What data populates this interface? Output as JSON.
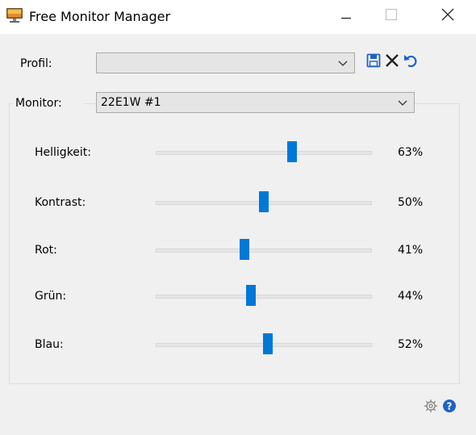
{
  "window": {
    "title": "Free Monitor Manager",
    "icon": "monitor-app-icon"
  },
  "profile": {
    "label": "Profil:",
    "value": "",
    "toolbar_icons": [
      "save-icon",
      "delete-icon",
      "undo-icon"
    ]
  },
  "monitor": {
    "label": "Monitor:",
    "value": "22E1W #1"
  },
  "sliders": [
    {
      "label": "Helligkeit:",
      "value": 63,
      "value_text": "63%"
    },
    {
      "label": "Kontrast:",
      "value": 50,
      "value_text": "50%"
    },
    {
      "label": "Rot:",
      "value": 41,
      "value_text": "41%"
    },
    {
      "label": "Grün:",
      "value": 44,
      "value_text": "44%"
    },
    {
      "label": "Blau:",
      "value": 52,
      "value_text": "52%"
    }
  ],
  "footer_icons": [
    "settings-icon",
    "help-icon"
  ],
  "colors": {
    "accent": "#0078d7",
    "background": "#f0f0f0",
    "help": "#1e63c4"
  }
}
